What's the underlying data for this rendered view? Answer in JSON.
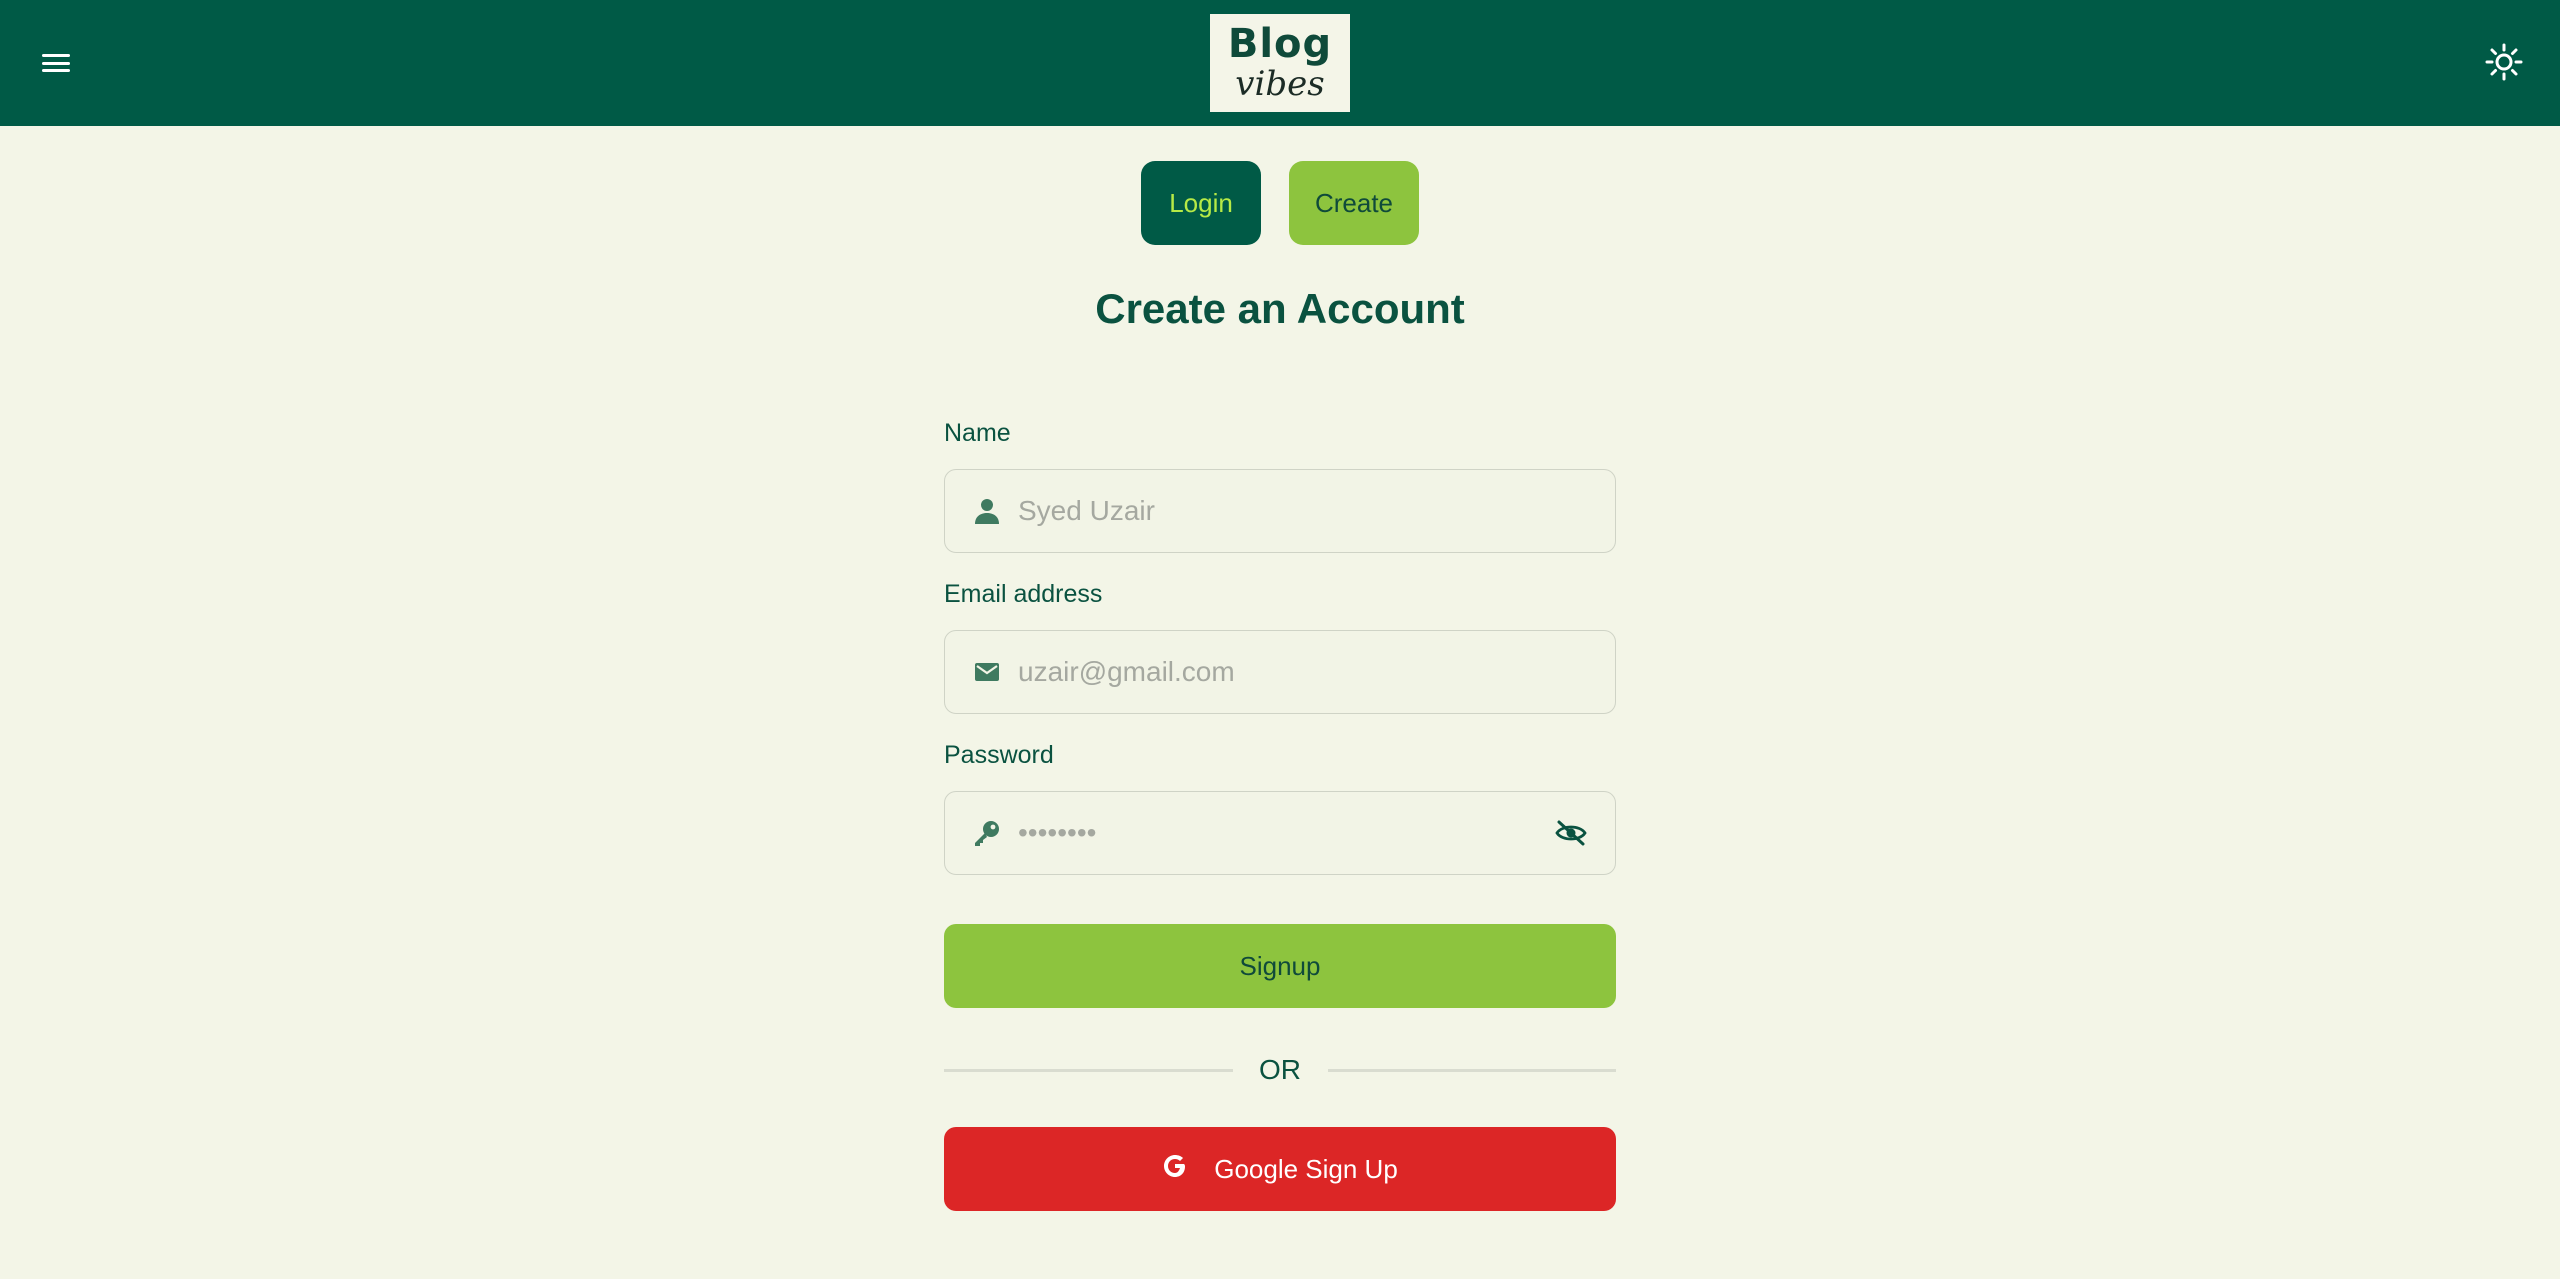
{
  "header": {
    "menu_icon": "hamburger-menu-icon",
    "logo_top": "Blog",
    "logo_bottom": "vibes",
    "theme_icon": "sun-icon"
  },
  "tabs": {
    "login_label": "Login",
    "create_label": "Create"
  },
  "page": {
    "title": "Create an Account"
  },
  "form": {
    "name": {
      "label": "Name",
      "placeholder": "Syed Uzair",
      "icon": "user-icon"
    },
    "email": {
      "label": "Email address",
      "placeholder": "uzair@gmail.com",
      "icon": "envelope-icon"
    },
    "password": {
      "label": "Password",
      "placeholder": "••••••••",
      "icon": "key-icon",
      "toggle_icon": "eye-slash-icon"
    },
    "signup_label": "Signup",
    "divider_text": "OR",
    "google_label": "Google Sign Up",
    "google_icon": "google-icon"
  },
  "colors": {
    "header_bg": "#005a46",
    "page_bg": "#f3f5e7",
    "primary_green": "#8dc43e",
    "dark_green": "#005a46",
    "google_red": "#dc2626"
  }
}
